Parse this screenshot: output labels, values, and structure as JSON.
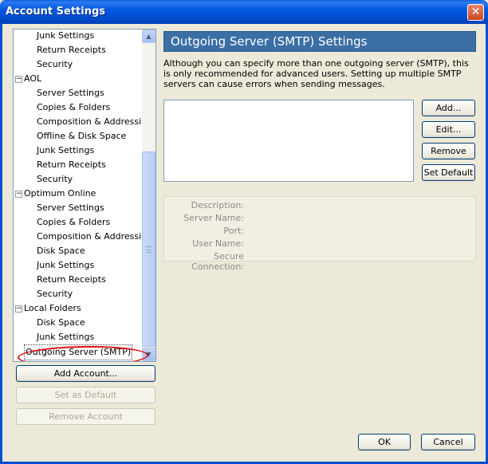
{
  "window": {
    "title": "Account Settings",
    "close_glyph": "✕"
  },
  "tree": {
    "items": [
      {
        "label": "Junk Settings",
        "level": 1
      },
      {
        "label": "Return Receipts",
        "level": 1
      },
      {
        "label": "Security",
        "level": 1
      },
      {
        "label": "AOL",
        "level": 0,
        "expander": "−"
      },
      {
        "label": "Server Settings",
        "level": 1
      },
      {
        "label": "Copies & Folders",
        "level": 1
      },
      {
        "label": "Composition & Addressing",
        "level": 1
      },
      {
        "label": "Offline & Disk Space",
        "level": 1
      },
      {
        "label": "Junk Settings",
        "level": 1
      },
      {
        "label": "Return Receipts",
        "level": 1
      },
      {
        "label": "Security",
        "level": 1
      },
      {
        "label": "Optimum Online",
        "level": 0,
        "expander": "−"
      },
      {
        "label": "Server Settings",
        "level": 1
      },
      {
        "label": "Copies & Folders",
        "level": 1
      },
      {
        "label": "Composition & Addressing",
        "level": 1
      },
      {
        "label": "Disk Space",
        "level": 1
      },
      {
        "label": "Junk Settings",
        "level": 1
      },
      {
        "label": "Return Receipts",
        "level": 1
      },
      {
        "label": "Security",
        "level": 1
      },
      {
        "label": "Local Folders",
        "level": 0,
        "expander": "−"
      },
      {
        "label": "Disk Space",
        "level": 1
      },
      {
        "label": "Junk Settings",
        "level": 1
      },
      {
        "label": "Outgoing Server (SMTP)",
        "level": 0,
        "selected": true
      }
    ],
    "scroll_up_glyph": "▲",
    "scroll_down_glyph": "▼"
  },
  "left_buttons": {
    "add_account": "Add Account...",
    "set_as_default": "Set as Default",
    "remove_account": "Remove Account"
  },
  "panel": {
    "heading": "Outgoing Server (SMTP) Settings",
    "intro": "Although you can specify more than one outgoing server (SMTP), this is only recommended for advanced users. Setting up multiple SMTP servers can cause errors when sending messages.",
    "buttons": {
      "add": "Add...",
      "edit": "Edit...",
      "remove": "Remove",
      "set_default": "Set Default"
    },
    "details": {
      "description": "Description:",
      "server_name": "Server Name:",
      "port": "Port:",
      "user_name": "User Name:",
      "secure_connection": "Secure Connection:"
    }
  },
  "footer": {
    "ok": "OK",
    "cancel": "Cancel"
  },
  "colors": {
    "title_bar": "#0054e3",
    "panel_header": "#3a6ea5",
    "annotation": "#e01010"
  }
}
